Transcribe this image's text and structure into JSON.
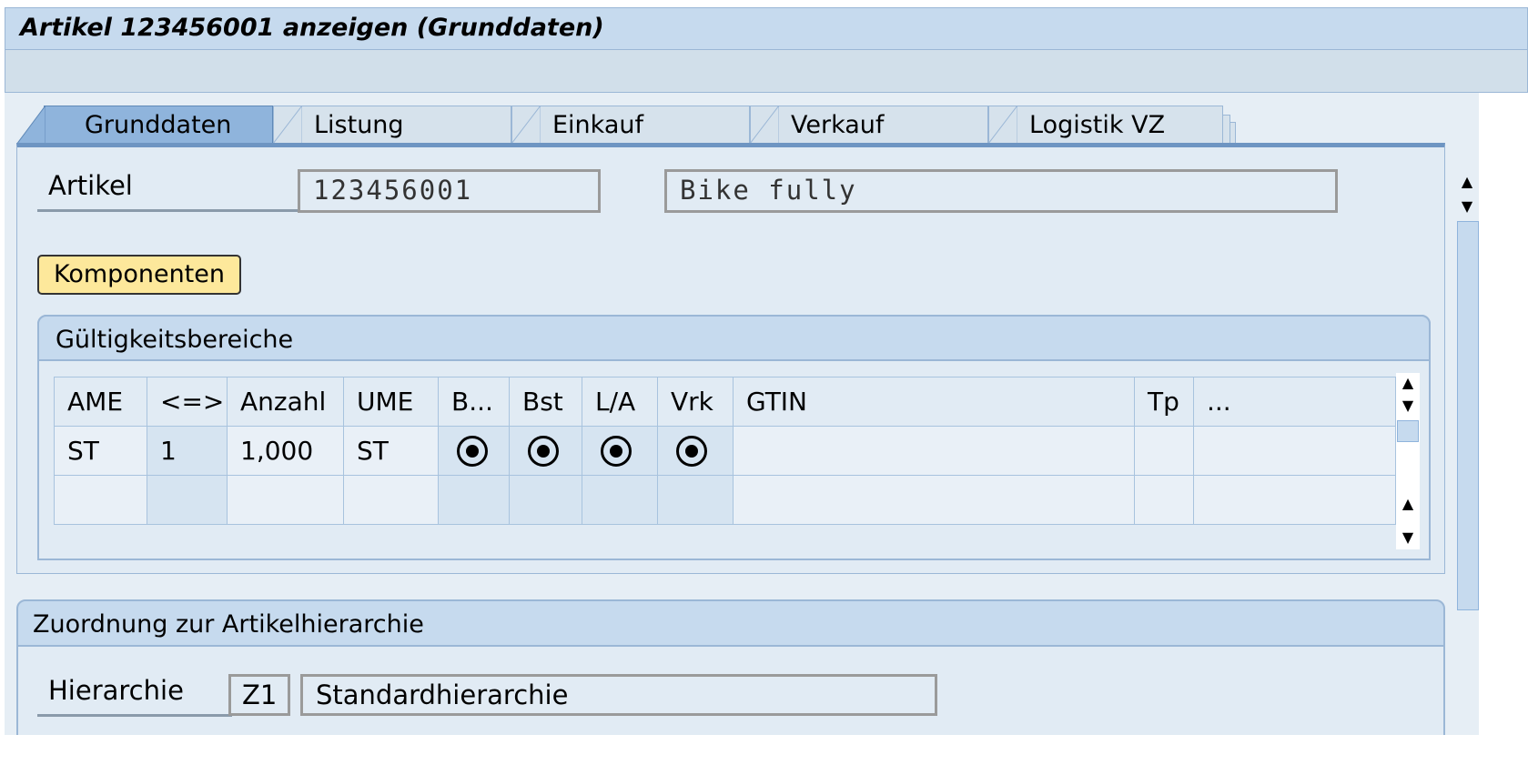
{
  "window": {
    "title": "Artikel 123456001 anzeigen  (Grunddaten)"
  },
  "tabs": [
    {
      "label": "Grunddaten",
      "active": true
    },
    {
      "label": "Listung"
    },
    {
      "label": "Einkauf"
    },
    {
      "label": "Verkauf"
    },
    {
      "label": "Logistik VZ"
    }
  ],
  "article": {
    "label": "Artikel",
    "number": "123456001",
    "description": "Bike fully"
  },
  "buttons": {
    "components": "Komponenten"
  },
  "validity": {
    "title": "Gültigkeitsbereiche",
    "columns": [
      "AME",
      "<=>",
      "Anzahl",
      "UME",
      "B...",
      "Bst",
      "L/A",
      "Vrk",
      "GTIN",
      "Tp",
      "..."
    ],
    "rows": [
      {
        "ame": "ST",
        "ratio": "1",
        "quantity": "1,000",
        "ume": "ST",
        "b": true,
        "bst": true,
        "la": true,
        "vrk": true,
        "gtin": "",
        "tp": ""
      }
    ]
  },
  "hierarchy": {
    "title": "Zuordnung zur Artikelhierarchie",
    "label": "Hierarchie",
    "code": "Z1",
    "name": "Standardhierarchie"
  },
  "icons": {
    "scroll_up": "arrow-up-icon",
    "scroll_down": "arrow-down-icon",
    "radio": "radio-selected-icon"
  },
  "colors": {
    "title_bar": "#c6daee",
    "active_tab": "#8fb4dc",
    "button": "#fde89b",
    "panel": "#e1ebf4"
  }
}
